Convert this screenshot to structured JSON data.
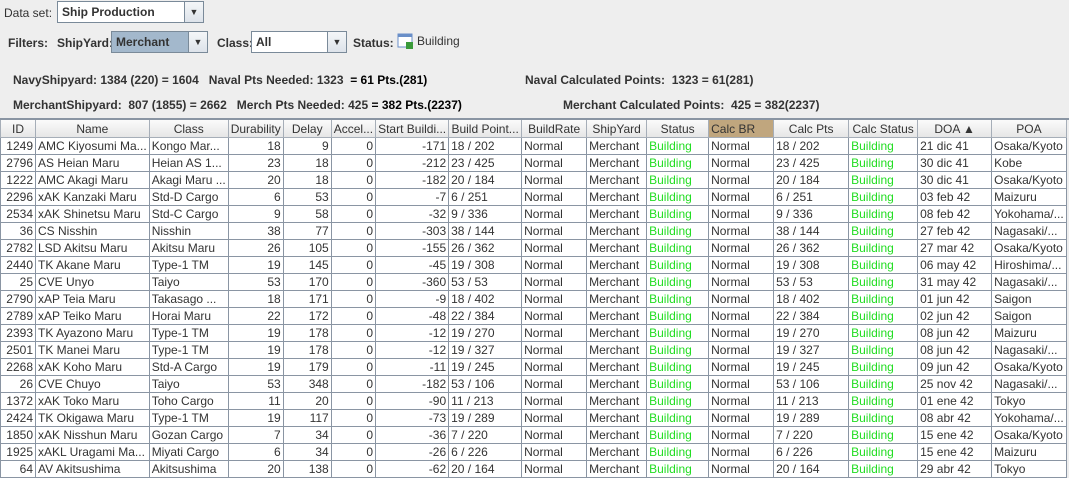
{
  "toolbar": {
    "dataset_label": "Data set:",
    "dataset_value": "Ship Production",
    "filters_label": "Filters:",
    "shipyard_label": "ShipYard:",
    "shipyard_value": "Merchant",
    "class_label": "Class:",
    "class_value": "All",
    "status_label": "Status:",
    "status_value": "Building"
  },
  "summary": {
    "navy": "NavyShipyard: 1384 (220) = 1604   Naval Pts Needed: 1323 ",
    "navy_result": " = 61 Pts.(281)",
    "merchant": "MerchantShipyard:  807 (1855) = 2662   Merch Pts Needed: 425 ",
    "merchant_result": "= 382 Pts.(2237)",
    "naval_calc": "Naval Calculated Points:  1323 = 61(281)",
    "merchant_calc": "Merchant Calculated Points:  425 = 382(2237)"
  },
  "table": {
    "columns": [
      "ID",
      "Name",
      "Class",
      "Durability",
      "Delay",
      "Accel...",
      "Start Buildi...",
      "Build Point...",
      "BuildRate",
      "ShipYard",
      "Status",
      "Calc BR",
      "Calc Pts",
      "Calc Status",
      "DOA ▲",
      "POA"
    ],
    "rows": [
      [
        "1249",
        "AMC Kiyosumi Ma...",
        "Kongo Mar...",
        "18",
        "9",
        "0",
        "-171",
        "18 / 202",
        "Normal",
        "Merchant",
        "Building",
        "Normal",
        "18 / 202",
        "Building",
        "21 dic 41",
        "Osaka/Kyoto"
      ],
      [
        "2796",
        "AS Heian Maru",
        "Heian AS 1...",
        "23",
        "18",
        "0",
        "-212",
        "23 / 425",
        "Normal",
        "Merchant",
        "Building",
        "Normal",
        "23 / 425",
        "Building",
        "30 dic 41",
        "Kobe"
      ],
      [
        "1222",
        "AMC Akagi Maru",
        "Akagi Maru ...",
        "20",
        "18",
        "0",
        "-182",
        "20 / 184",
        "Normal",
        "Merchant",
        "Building",
        "Normal",
        "20 / 184",
        "Building",
        "30 dic 41",
        "Osaka/Kyoto"
      ],
      [
        "2296",
        "xAK Kanzaki Maru",
        "Std-D Cargo",
        "6",
        "53",
        "0",
        "-7",
        "6 / 251",
        "Normal",
        "Merchant",
        "Building",
        "Normal",
        "6 / 251",
        "Building",
        "03 feb 42",
        "Maizuru"
      ],
      [
        "2534",
        "xAK Shinetsu Maru",
        "Std-C Cargo",
        "9",
        "58",
        "0",
        "-32",
        "9 / 336",
        "Normal",
        "Merchant",
        "Building",
        "Normal",
        "9 / 336",
        "Building",
        "08 feb 42",
        "Yokohama/..."
      ],
      [
        "36",
        "CS Nisshin",
        "Nisshin",
        "38",
        "77",
        "0",
        "-303",
        "38 / 144",
        "Normal",
        "Merchant",
        "Building",
        "Normal",
        "38 / 144",
        "Building",
        "27 feb 42",
        "Nagasaki/..."
      ],
      [
        "2782",
        "LSD Akitsu Maru",
        "Akitsu Maru",
        "26",
        "105",
        "0",
        "-155",
        "26 / 362",
        "Normal",
        "Merchant",
        "Building",
        "Normal",
        "26 / 362",
        "Building",
        "27 mar 42",
        "Osaka/Kyoto"
      ],
      [
        "2440",
        "TK Akane Maru",
        "Type-1 TM",
        "19",
        "145",
        "0",
        "-45",
        "19 / 308",
        "Normal",
        "Merchant",
        "Building",
        "Normal",
        "19 / 308",
        "Building",
        "06 may 42",
        "Hiroshima/..."
      ],
      [
        "25",
        "CVE Unyo",
        "Taiyo",
        "53",
        "170",
        "0",
        "-360",
        "53 / 53",
        "Normal",
        "Merchant",
        "Building",
        "Normal",
        "53 / 53",
        "Building",
        "31 may 42",
        "Nagasaki/..."
      ],
      [
        "2790",
        "xAP Teia Maru",
        "Takasago ...",
        "18",
        "171",
        "0",
        "-9",
        "18 / 402",
        "Normal",
        "Merchant",
        "Building",
        "Normal",
        "18 / 402",
        "Building",
        "01 jun 42",
        "Saigon"
      ],
      [
        "2789",
        "xAP Teiko Maru",
        "Horai Maru",
        "22",
        "172",
        "0",
        "-48",
        "22 / 384",
        "Normal",
        "Merchant",
        "Building",
        "Normal",
        "22 / 384",
        "Building",
        "02 jun 42",
        "Saigon"
      ],
      [
        "2393",
        "TK Ayazono Maru",
        "Type-1 TM",
        "19",
        "178",
        "0",
        "-12",
        "19 / 270",
        "Normal",
        "Merchant",
        "Building",
        "Normal",
        "19 / 270",
        "Building",
        "08 jun 42",
        "Maizuru"
      ],
      [
        "2501",
        "TK Manei Maru",
        "Type-1 TM",
        "19",
        "178",
        "0",
        "-12",
        "19 / 327",
        "Normal",
        "Merchant",
        "Building",
        "Normal",
        "19 / 327",
        "Building",
        "08 jun 42",
        "Nagasaki/..."
      ],
      [
        "2268",
        "xAK Koho Maru",
        "Std-A Cargo",
        "19",
        "179",
        "0",
        "-11",
        "19 / 245",
        "Normal",
        "Merchant",
        "Building",
        "Normal",
        "19 / 245",
        "Building",
        "09 jun 42",
        "Osaka/Kyoto"
      ],
      [
        "26",
        "CVE Chuyo",
        "Taiyo",
        "53",
        "348",
        "0",
        "-182",
        "53 / 106",
        "Normal",
        "Merchant",
        "Building",
        "Normal",
        "53 / 106",
        "Building",
        "25 nov 42",
        "Nagasaki/..."
      ],
      [
        "1372",
        "xAK Toko Maru",
        "Toho Cargo",
        "11",
        "20",
        "0",
        "-90",
        "11 / 213",
        "Normal",
        "Merchant",
        "Building",
        "Normal",
        "11 / 213",
        "Building",
        "01 ene 42",
        "Tokyo"
      ],
      [
        "2424",
        "TK Okigawa Maru",
        "Type-1 TM",
        "19",
        "117",
        "0",
        "-73",
        "19 / 289",
        "Normal",
        "Merchant",
        "Building",
        "Normal",
        "19 / 289",
        "Building",
        "08 abr 42",
        "Yokohama/..."
      ],
      [
        "1850",
        "xAK Nisshun Maru",
        "Gozan Cargo",
        "7",
        "34",
        "0",
        "-36",
        "7 / 220",
        "Normal",
        "Merchant",
        "Building",
        "Normal",
        "7 / 220",
        "Building",
        "15 ene 42",
        "Osaka/Kyoto"
      ],
      [
        "1925",
        "xAKL Uragami Ma...",
        "Miyati Cargo",
        "6",
        "34",
        "0",
        "-26",
        "6 / 226",
        "Normal",
        "Merchant",
        "Building",
        "Normal",
        "6 / 226",
        "Building",
        "15 ene 42",
        "Maizuru"
      ],
      [
        "64",
        "AV Akitsushima",
        "Akitsushima",
        "20",
        "138",
        "0",
        "-62",
        "20 / 164",
        "Normal",
        "Merchant",
        "Building",
        "Normal",
        "20 / 164",
        "Building",
        "29 abr 42",
        "Tokyo"
      ]
    ]
  },
  "colors": {
    "building": "#22dd22",
    "highlight_header": "#c0a67e",
    "selected_combo": "#a3b8cc"
  }
}
